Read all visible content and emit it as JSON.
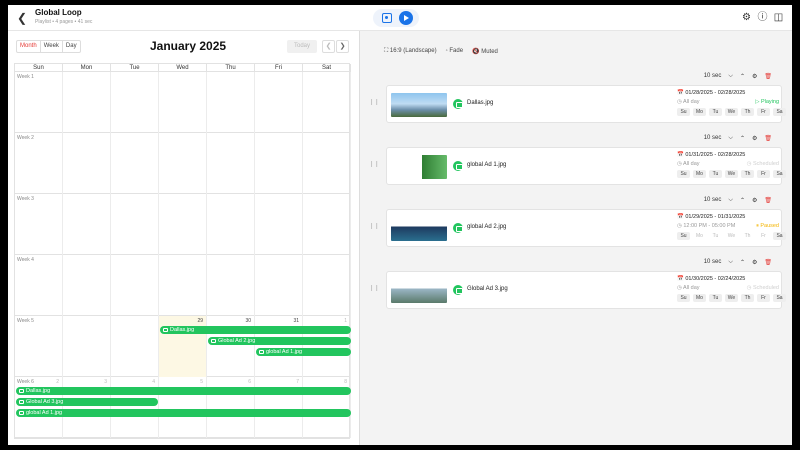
{
  "header": {
    "title": "Global Loop",
    "subtitle": "Playlist • 4 pages • 41 sec"
  },
  "calendar": {
    "views": [
      "Month",
      "Week",
      "Day"
    ],
    "active_view": "Month",
    "month_label": "January 2025",
    "today_label": "Today",
    "weekdays": [
      "Sun",
      "Mon",
      "Tue",
      "Wed",
      "Thu",
      "Fri",
      "Sat"
    ],
    "weeks": [
      {
        "label": "Week 1",
        "days": [
          "",
          "",
          "",
          "",
          "",
          "",
          ""
        ]
      },
      {
        "label": "Week 2",
        "days": [
          "",
          "",
          "",
          "",
          "",
          "",
          ""
        ]
      },
      {
        "label": "Week 3",
        "days": [
          "",
          "",
          "",
          "",
          "",
          "",
          ""
        ]
      },
      {
        "label": "Week 4",
        "days": [
          "",
          "",
          "",
          "",
          "",
          "",
          ""
        ]
      },
      {
        "label": "Week 5",
        "days": [
          "",
          "",
          "",
          "29",
          "30",
          "31",
          "1"
        ]
      },
      {
        "label": "Week 6",
        "days": [
          "2",
          "3",
          "4",
          "5",
          "6",
          "7",
          "8"
        ]
      }
    ],
    "events": [
      {
        "label": "Dallas.jpg",
        "week": 4,
        "start": 3,
        "end": 7,
        "lane": 0
      },
      {
        "label": "Global Ad 2.jpg",
        "week": 4,
        "start": 4,
        "end": 7,
        "lane": 1
      },
      {
        "label": "global Ad 1.jpg",
        "week": 4,
        "start": 5,
        "end": 7,
        "lane": 2
      },
      {
        "label": "Dallas.jpg",
        "week": 5,
        "start": 0,
        "end": 7,
        "lane": 0
      },
      {
        "label": "Global Ad 3.jpg",
        "week": 5,
        "start": 0,
        "end": 3,
        "lane": 1
      },
      {
        "label": "global Ad 1.jpg",
        "week": 5,
        "start": 0,
        "end": 7,
        "lane": 2
      }
    ]
  },
  "options": {
    "aspect": "16:9 (Landscape)",
    "transition": "Fade",
    "audio": "Muted"
  },
  "weekday_short": [
    "Su",
    "Mo",
    "Tu",
    "We",
    "Th",
    "Fr",
    "Sa"
  ],
  "items": [
    {
      "duration": "10 sec",
      "file": "Dallas.jpg",
      "date_range": "01/28/2025 - 02/28/2025",
      "time": "All day",
      "status": "Playing",
      "status_color": "#22c55e",
      "days_on": [
        true,
        true,
        true,
        true,
        true,
        true,
        true
      ]
    },
    {
      "duration": "10 sec",
      "file": "global Ad 1.jpg",
      "date_range": "01/31/2025 - 02/28/2025",
      "time": "All day",
      "status": "Scheduled",
      "status_color": "#cfcfcf",
      "days_on": [
        true,
        true,
        true,
        true,
        true,
        true,
        true
      ]
    },
    {
      "duration": "10 sec",
      "file": "global Ad 2.jpg",
      "date_range": "01/29/2025 - 01/31/2025",
      "time": "12:00 PM - 05:00 PM",
      "status": "Paused",
      "status_color": "#f4b400",
      "days_on": [
        true,
        false,
        false,
        false,
        false,
        false,
        true
      ]
    },
    {
      "duration": "10 sec",
      "file": "Global Ad 3.jpg",
      "date_range": "01/30/2025 - 02/24/2025",
      "time": "All day",
      "status": "Scheduled",
      "status_color": "#cfcfcf",
      "days_on": [
        true,
        true,
        true,
        true,
        true,
        true,
        true
      ]
    }
  ]
}
